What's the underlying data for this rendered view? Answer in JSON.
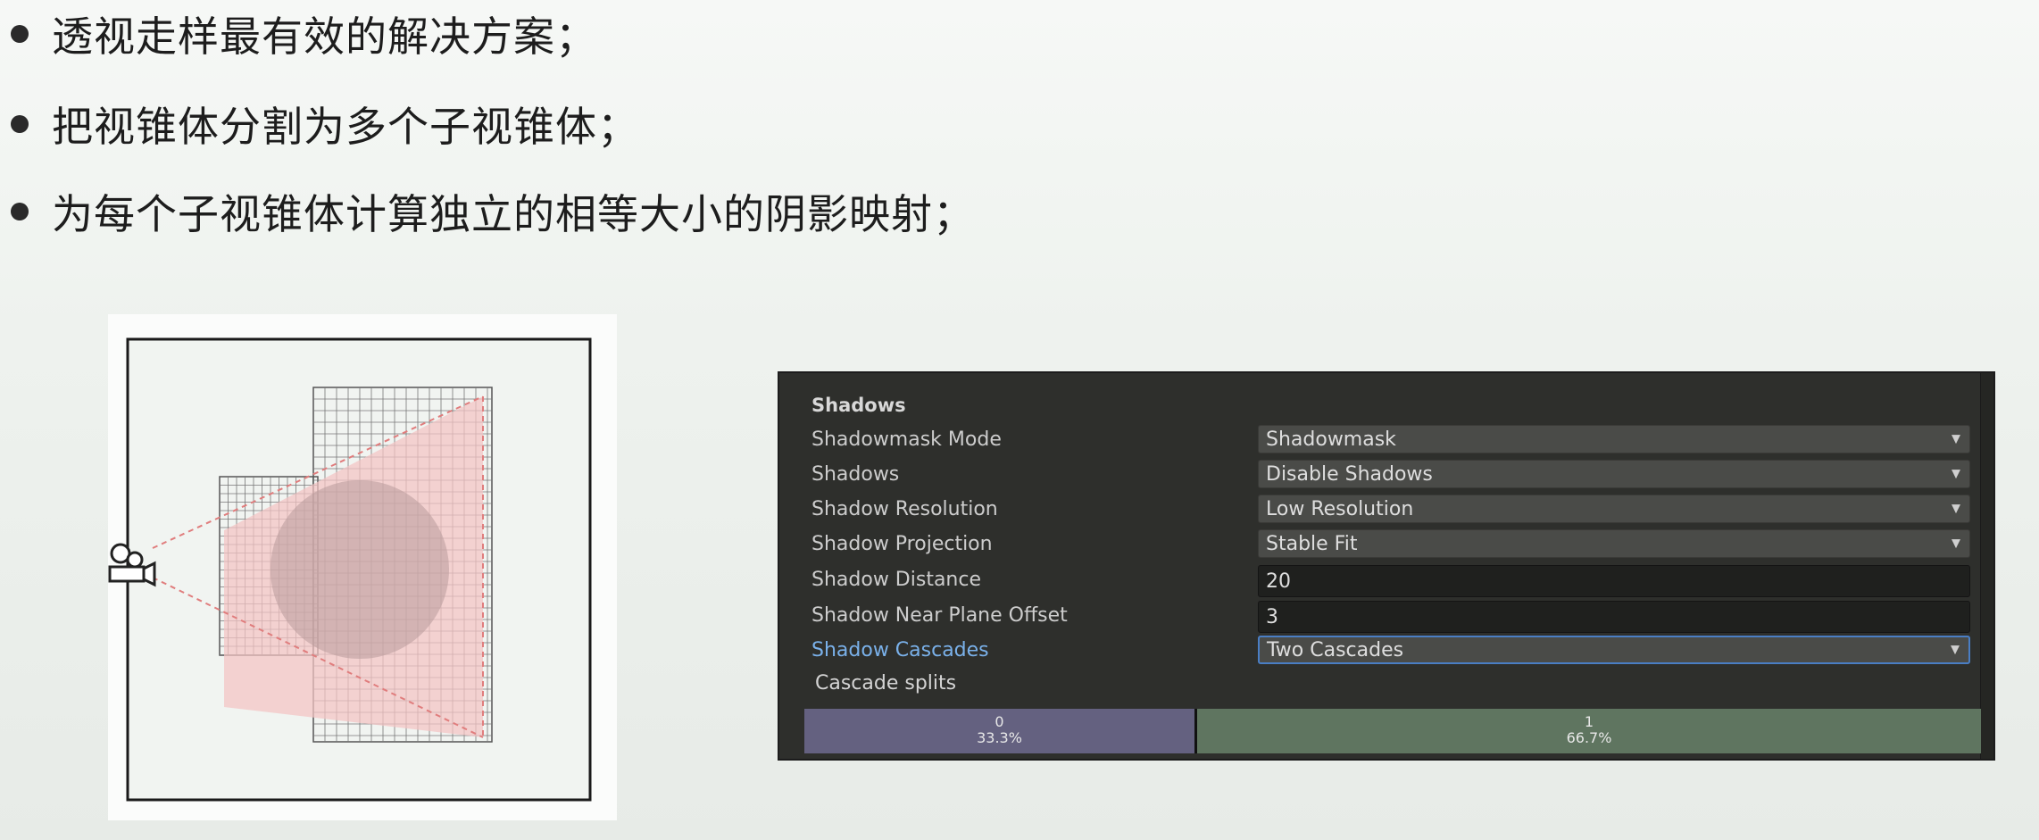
{
  "bullets": [
    "透视走样最有效的解决方案；",
    "把视锥体分割为多个子视锥体；",
    "为每个子视锥体计算独立的相等大小的阴影映射；"
  ],
  "panel": {
    "header": "Shadows",
    "rows": [
      {
        "label": "Shadowmask Mode",
        "value": "Shadowmask",
        "kind": "dropdown"
      },
      {
        "label": "Shadows",
        "value": "Disable Shadows",
        "kind": "dropdown"
      },
      {
        "label": "Shadow Resolution",
        "value": "Low Resolution",
        "kind": "dropdown"
      },
      {
        "label": "Shadow Projection",
        "value": "Stable Fit",
        "kind": "dropdown"
      },
      {
        "label": "Shadow Distance",
        "value": "20",
        "kind": "text"
      },
      {
        "label": "Shadow Near Plane Offset",
        "value": "3",
        "kind": "text"
      },
      {
        "label": "Shadow Cascades",
        "value": "Two Cascades",
        "kind": "dropdown"
      }
    ],
    "cascade_label": "Cascade splits",
    "splits": [
      {
        "index": "0",
        "percent": "33.3%"
      },
      {
        "index": "1",
        "percent": "66.7%"
      }
    ],
    "dropdown_arrow": "▼"
  },
  "colors": {
    "active_label": "#7ab1ea",
    "split0": "#646180",
    "split1": "#5f7560",
    "frustum_fill": "#f4c4c4",
    "sphere_fill": "#b89a9a"
  }
}
